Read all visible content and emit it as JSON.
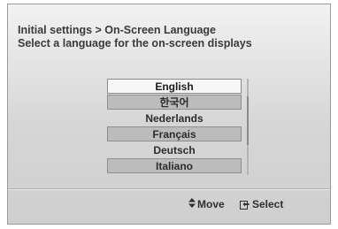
{
  "header": {
    "breadcrumb": "Initial settings > On-Screen Language",
    "instruction": "Select a language for the on-screen displays"
  },
  "languages": [
    {
      "label": "English"
    },
    {
      "label": "한국어"
    },
    {
      "label": "Nederlands"
    },
    {
      "label": "Français"
    },
    {
      "label": "Deutsch"
    },
    {
      "label": "Italiano"
    }
  ],
  "selected_language": "English",
  "footer": {
    "move_label": "Move",
    "move_icon": "up-down-arrows-icon",
    "select_label": "Select",
    "select_icon": "enter-icon"
  }
}
